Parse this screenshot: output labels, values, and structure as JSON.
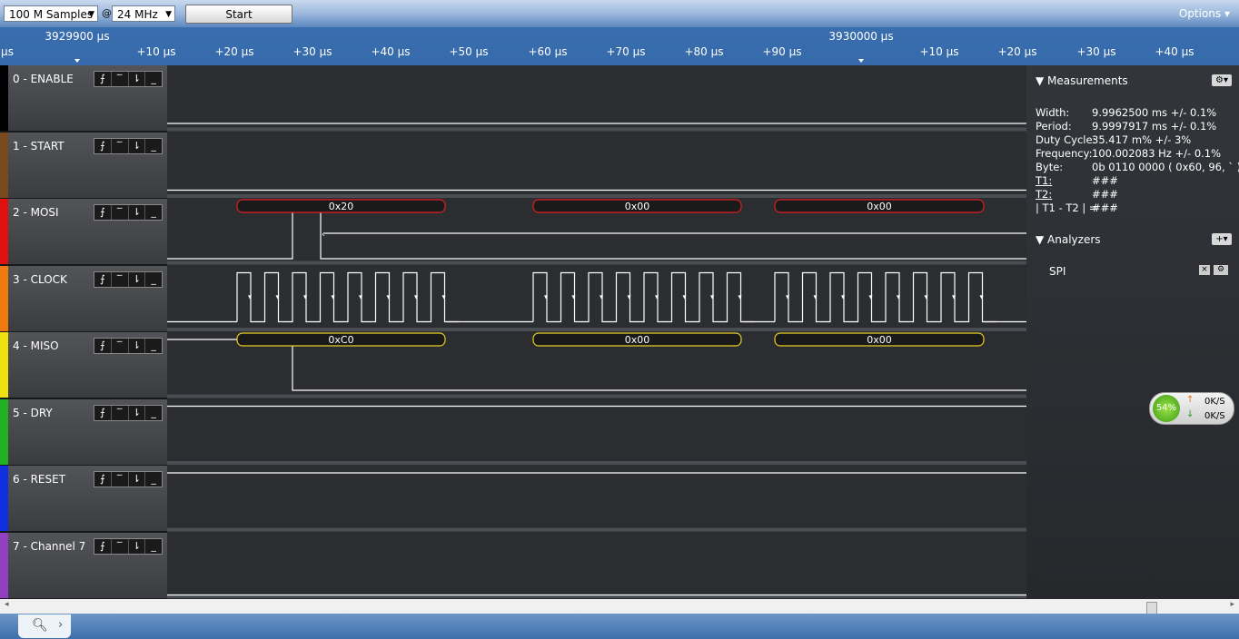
{
  "toolbar": {
    "samples_value": "100 M Samples",
    "at_symbol": "@",
    "rate_value": "24 MHz",
    "start_label": "Start",
    "options_label": "Options"
  },
  "ruler": {
    "major_labels": [
      "3929900 µs",
      "3930000 µs"
    ],
    "tick_labels": [
      "µs",
      "+10 µs",
      "+20 µs",
      "+30 µs",
      "+40 µs",
      "+50 µs",
      "+60 µs",
      "+70 µs",
      "+80 µs",
      "+90 µs",
      "+10 µs",
      "+20 µs",
      "+30 µs",
      "+40 µs"
    ]
  },
  "channels": [
    {
      "name": "0 - ENABLE",
      "color": "#000000"
    },
    {
      "name": "1 - START",
      "color": "#7a4a1e"
    },
    {
      "name": "2 - MOSI",
      "color": "#e01010"
    },
    {
      "name": "3 - CLOCK",
      "color": "#f07a10"
    },
    {
      "name": "4 - MISO",
      "color": "#f0e010"
    },
    {
      "name": "5 - DRY",
      "color": "#20b020"
    },
    {
      "name": "6 - RESET",
      "color": "#1030e0"
    },
    {
      "name": "7 - Channel 7",
      "color": "#9040c0"
    }
  ],
  "trigger_glyphs": [
    "⨍",
    "‾",
    "⇂",
    "_"
  ],
  "decoded": {
    "mosi": [
      "0x20",
      "0x00",
      "0x00"
    ],
    "miso": [
      "0xC0",
      "0x00",
      "0x00"
    ]
  },
  "measurements": {
    "title": "Measurements",
    "rows": [
      {
        "label": "Width:",
        "value": "9.9962500 ms +/- 0.1%"
      },
      {
        "label": "Period:",
        "value": "9.9997917 ms +/- 0.1%"
      },
      {
        "label": "Duty Cycle:",
        "value": "35.417 m% +/- 3%"
      },
      {
        "label": "Frequency:",
        "value": "100.002083 Hz +/- 0.1%"
      },
      {
        "label": "Byte:",
        "value": "0b  0110  0000 ( 0x60, 96, ` )"
      },
      {
        "label": "T1:",
        "value": "###"
      },
      {
        "label": "T2:",
        "value": "###"
      },
      {
        "label": "| T1 - T2 | =",
        "value": "###"
      }
    ]
  },
  "analyzers": {
    "title": "Analyzers",
    "items": [
      "SPI"
    ]
  },
  "net_meter": {
    "percent": "54%",
    "up": "0K/S",
    "down": "0K/S"
  }
}
